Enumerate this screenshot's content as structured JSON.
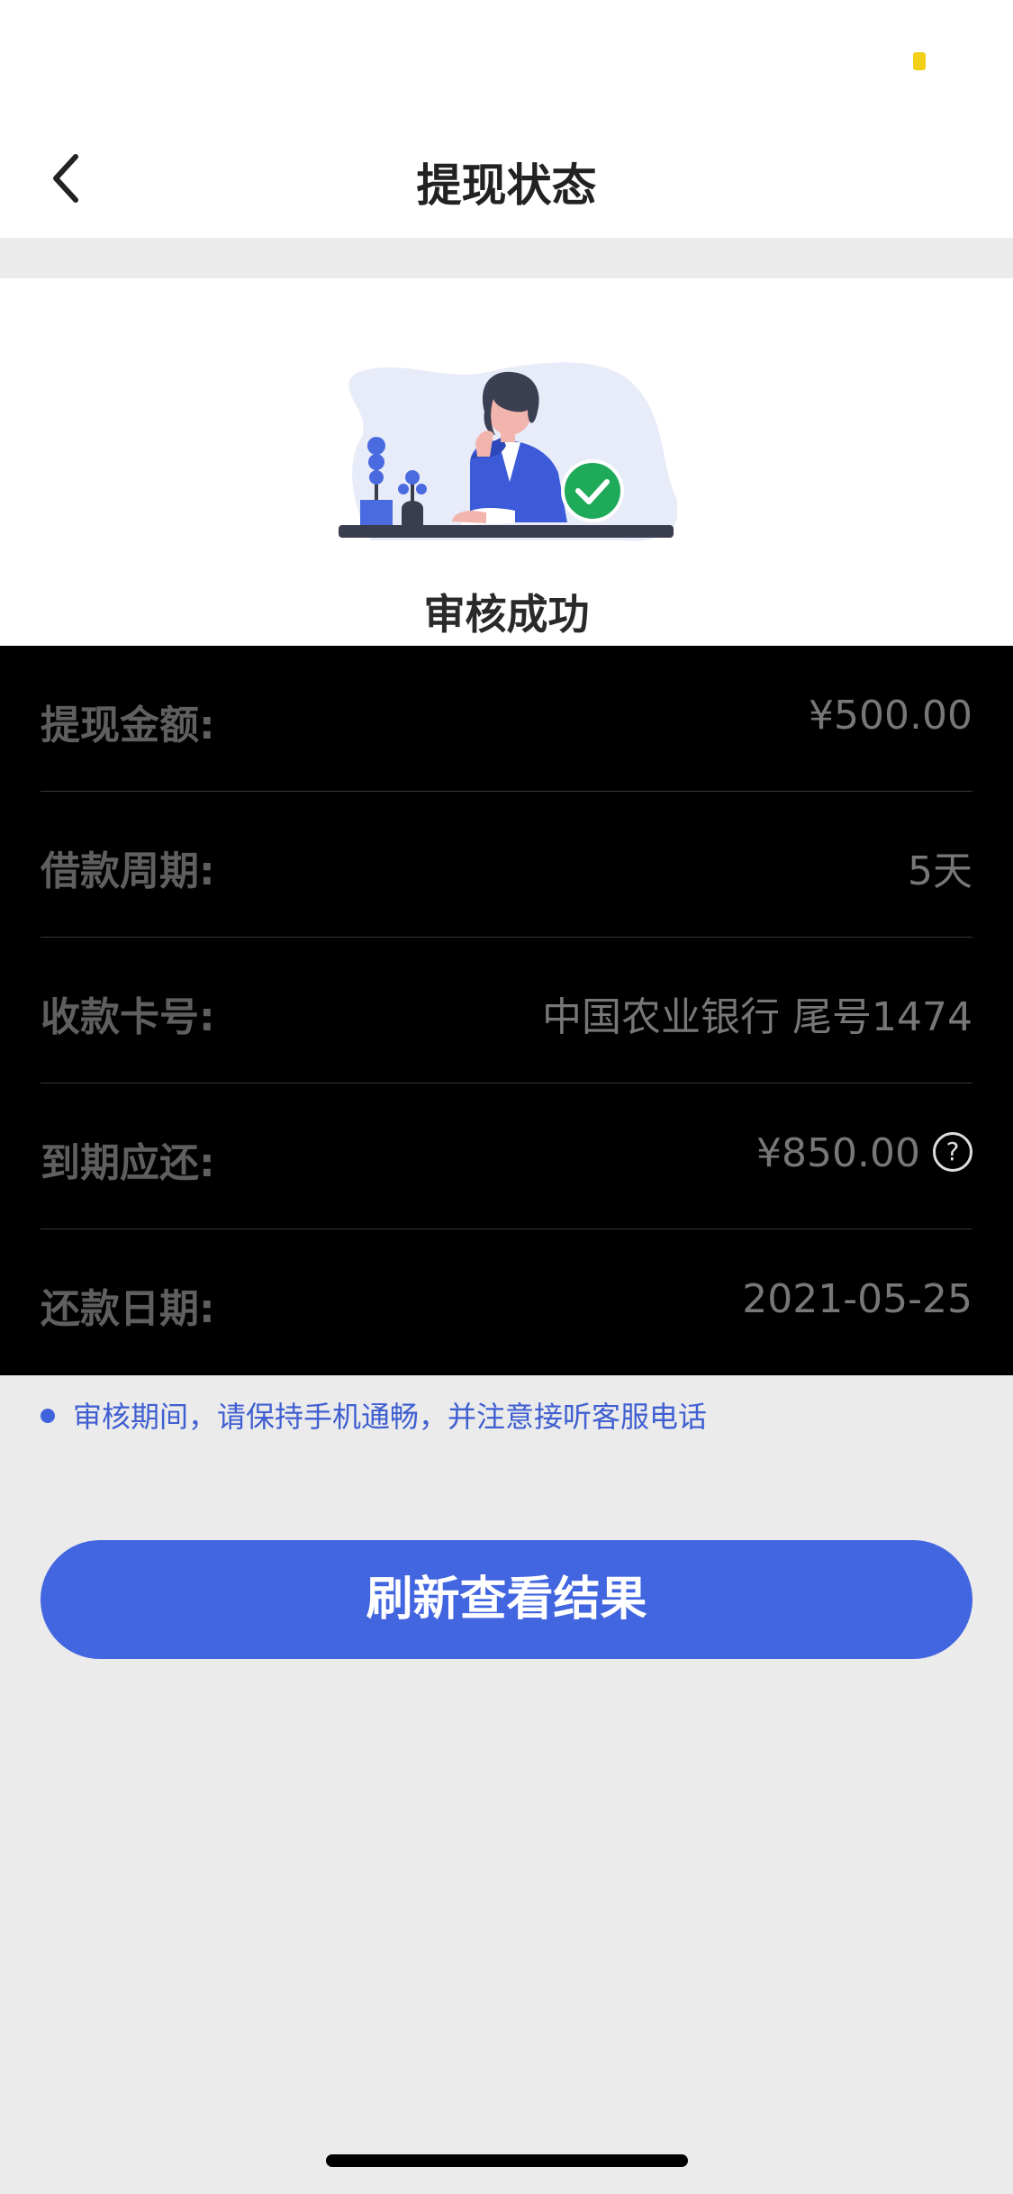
{
  "header": {
    "title": "提现状态"
  },
  "status": {
    "text": "审核成功"
  },
  "details": [
    {
      "label": "提现金额:",
      "value": "¥500.00"
    },
    {
      "label": "借款周期:",
      "value": "5天"
    },
    {
      "label": "收款卡号:",
      "value": "中国农业银行 尾号1474"
    },
    {
      "label": "到期应还:",
      "value": "¥850.00"
    },
    {
      "label": "还款日期:",
      "value": "2021-05-25"
    }
  ],
  "help_icon": "?",
  "notice": {
    "text": "审核期间，请保持手机通畅，并注意接听客服电话"
  },
  "button": {
    "label": "刷新查看结果"
  },
  "colors": {
    "accent": "#4265e0",
    "battery": "#f3d017",
    "success": "#1faa5a"
  }
}
